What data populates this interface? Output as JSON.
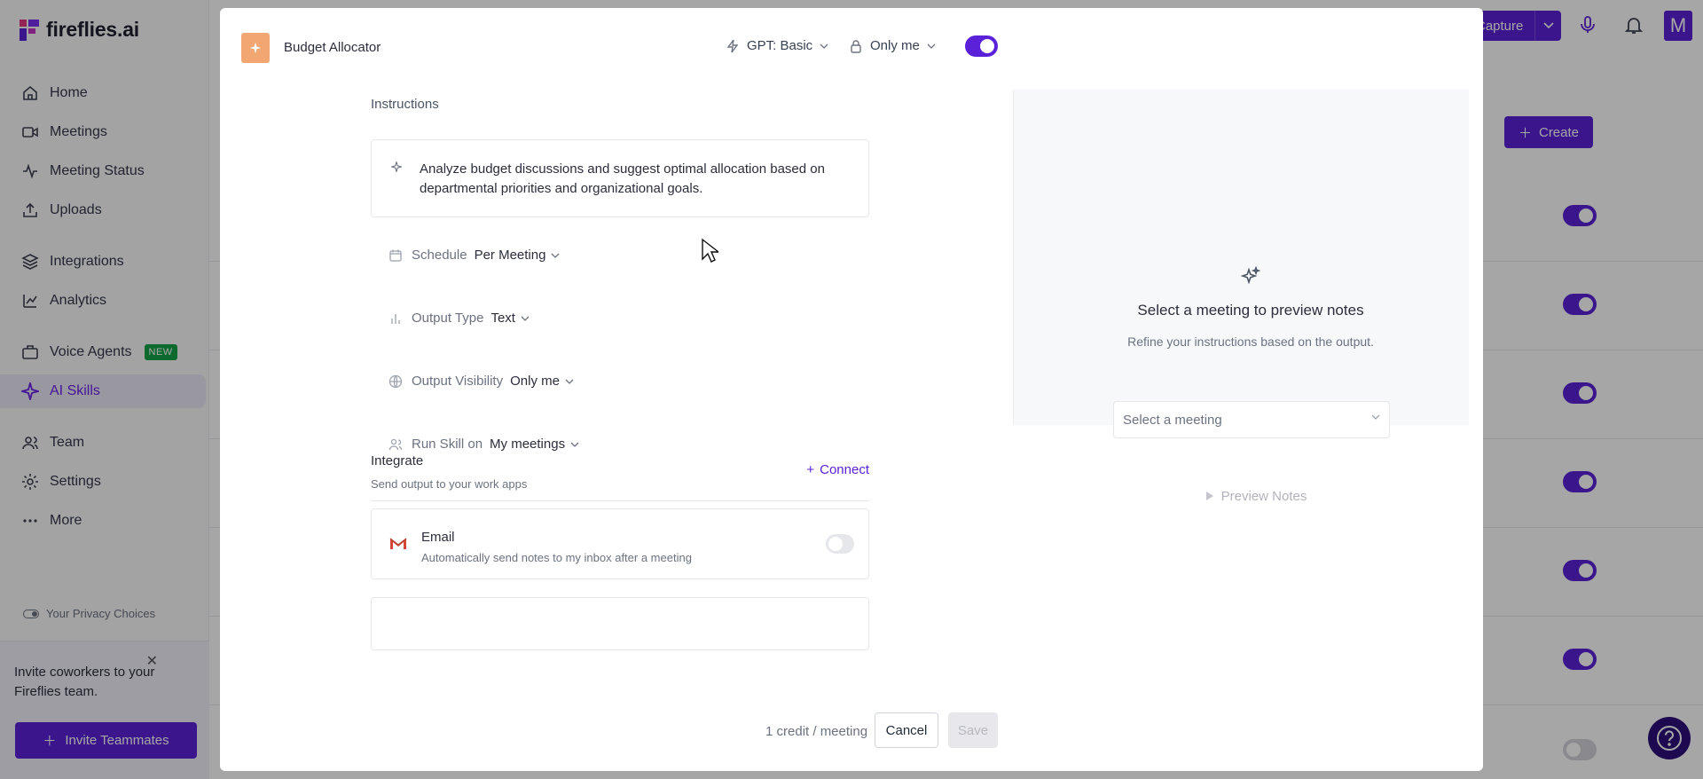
{
  "app": {
    "brand": "fireflies.ai",
    "nav": [
      {
        "label": "Home",
        "icon": "home-icon"
      },
      {
        "label": "Meetings",
        "icon": "video-icon"
      },
      {
        "label": "Meeting Status",
        "icon": "activity-icon"
      },
      {
        "label": "Uploads",
        "icon": "upload-icon"
      },
      {
        "label": "Integrations",
        "icon": "layers-icon"
      },
      {
        "label": "Analytics",
        "icon": "chart-icon"
      },
      {
        "label": "Voice Agents",
        "icon": "briefcase-icon",
        "badge": "NEW"
      },
      {
        "label": "AI Skills",
        "icon": "sparkle-icon",
        "active": true
      },
      {
        "label": "Team",
        "icon": "users-icon"
      },
      {
        "label": "Settings",
        "icon": "gear-icon"
      },
      {
        "label": "More",
        "icon": "dots-icon"
      }
    ],
    "privacy": "Your Privacy Choices",
    "invite": {
      "text": "Invite coworkers to your Fireflies team.",
      "button": "Invite Teammates"
    },
    "topbar": {
      "capture": "Capture",
      "avatar": "M"
    },
    "create": "Create"
  },
  "modal": {
    "skill_name": "Budget Allocator",
    "model": "GPT: Basic",
    "visibility": "Only me",
    "enabled": true,
    "instructions_label": "Instructions",
    "instructions": "Analyze budget discussions and suggest optimal allocation based on departmental priorities and organizational goals.",
    "options": [
      {
        "label": "Schedule",
        "value": "Per Meeting",
        "icon": "calendar-icon"
      },
      {
        "label": "Output Type",
        "value": "Text",
        "icon": "bar-chart-icon"
      },
      {
        "label": "Output Visibility",
        "value": "Only me",
        "icon": "globe-icon"
      },
      {
        "label": "Run Skill on",
        "value": "My meetings",
        "icon": "users-icon"
      }
    ],
    "integrate": {
      "title": "Integrate",
      "subtitle": "Send output to your work apps",
      "connect": "Connect",
      "email_title": "Email",
      "email_sub": "Automatically send notes to my inbox after a meeting"
    },
    "footer": {
      "credit": "1 credit / meeting",
      "cancel": "Cancel",
      "save": "Save"
    },
    "preview": {
      "title": "Select a meeting to preview notes",
      "subtitle": "Refine your instructions based on the output.",
      "select_placeholder": "Select a meeting",
      "button": "Preview Notes"
    }
  },
  "colors": {
    "accent": "#5b21d8",
    "skill_icon": "#f2a772"
  }
}
